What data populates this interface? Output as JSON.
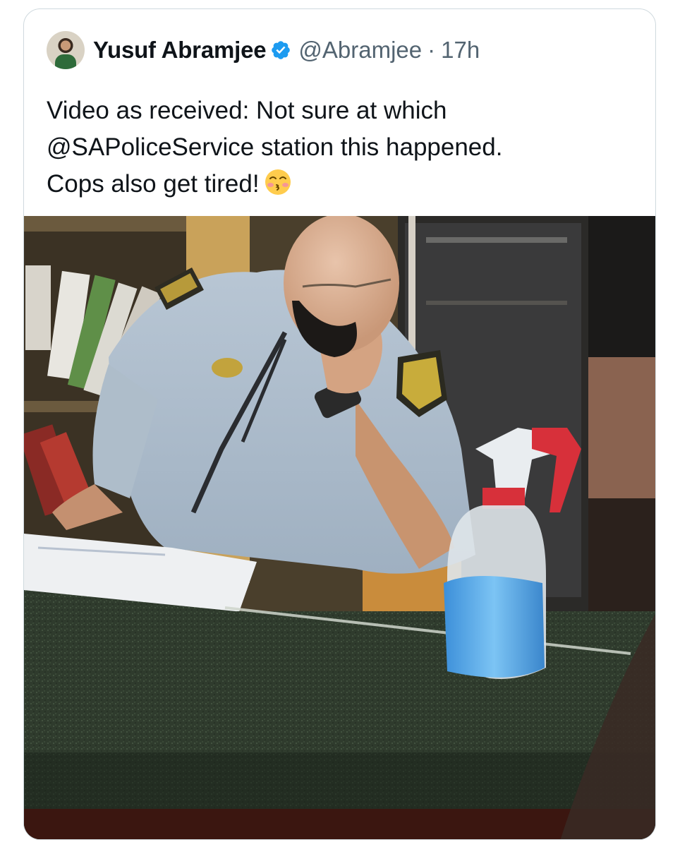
{
  "tweet": {
    "author": {
      "display_name": "Yusuf Abramjee",
      "handle": "@Abramjee",
      "verified": true,
      "avatar_icon": "profile-photo"
    },
    "separator": "·",
    "timestamp": "17h",
    "text_lines": [
      "Video as received: Not sure at which",
      "@SAPoliceService station this happened.",
      "Cops also get tired!"
    ],
    "emoji_icon": "face-blowing-kiss-emoji",
    "media": {
      "type": "video-still",
      "description_icon": "police-officer-at-desk-photo"
    }
  },
  "colors": {
    "text": "#0f1419",
    "secondary_text": "#536471",
    "verified_blue": "#1d9bf0",
    "card_border": "#cfd9de"
  }
}
